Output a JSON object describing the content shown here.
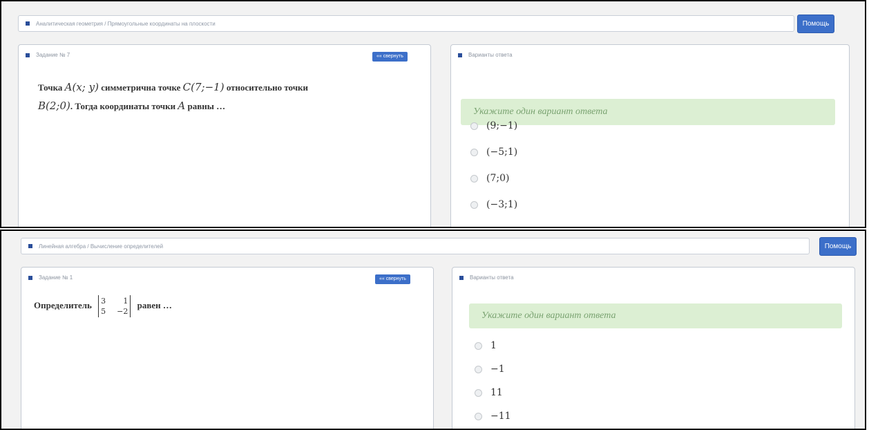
{
  "screens": [
    {
      "breadcrumb": "Аналитическая геометрия / Прямоугольные координаты на плоскости",
      "help_label": "Помощь",
      "task": {
        "title": "Задание № 7",
        "minimize_label": "«« свернуть",
        "q_line1_a": "Точка",
        "q_A": "A(x; y)",
        "q_line1_b": "симметрична точке",
        "q_C": "C(7;−1)",
        "q_line1_c": "относительно точки",
        "q_B": "B(2;0)",
        "q_line2_b": ". Тогда координаты точки",
        "q_A2": "A",
        "q_line2_c": "равны …"
      },
      "answers": {
        "title": "Варианты ответа",
        "hint": "Укажите один вариант ответа",
        "options": [
          "(9;−1)",
          "(−5;1)",
          "(7;0)",
          "(−3;1)"
        ]
      }
    },
    {
      "breadcrumb": "Линейная алгебра / Вычисление определителей",
      "help_label": "Помощь",
      "task": {
        "title": "Задание № 1",
        "minimize_label": "«« свернуть",
        "q_before": "Определитель",
        "det": [
          "3",
          "1",
          "5",
          "−2"
        ],
        "q_after": "равен …"
      },
      "answers": {
        "title": "Варианты ответа",
        "hint": "Укажите один вариант ответа",
        "options": [
          "1",
          "−1",
          "11",
          "−11"
        ]
      }
    }
  ]
}
